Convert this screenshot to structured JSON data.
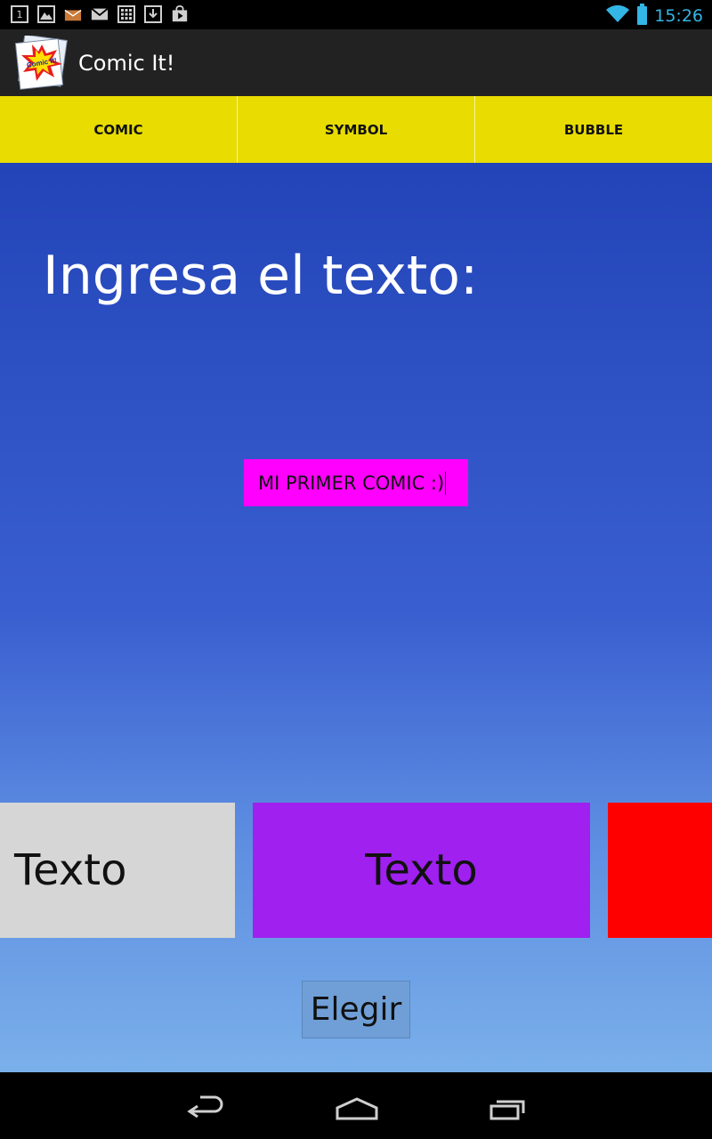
{
  "status_bar": {
    "time": "15:26",
    "left_icons": [
      "calendar-icon",
      "image-icon",
      "mail-icon",
      "gmail-icon",
      "grid-app-icon",
      "download-icon",
      "play-store-icon"
    ],
    "calendar_day": "1"
  },
  "action_bar": {
    "title": "Comic It!",
    "logo_text": "Comic It!"
  },
  "tabs": [
    {
      "label": "COMIC"
    },
    {
      "label": "SYMBOL"
    },
    {
      "label": "BUBBLE"
    }
  ],
  "main": {
    "prompt": "Ingresa el texto:",
    "input_value": "MI PRIMER COMIC :)",
    "style_cards": [
      {
        "label": "Texto",
        "color": "#d6d6d6"
      },
      {
        "label": "Texto",
        "color": "#a020f0"
      },
      {
        "label": "",
        "color": "#ff0000"
      }
    ],
    "choose_button": "Elegir"
  },
  "colors": {
    "tab_bar": "#e8dc00",
    "input_background": "#ff00ff",
    "status_accent": "#33b5e5"
  }
}
